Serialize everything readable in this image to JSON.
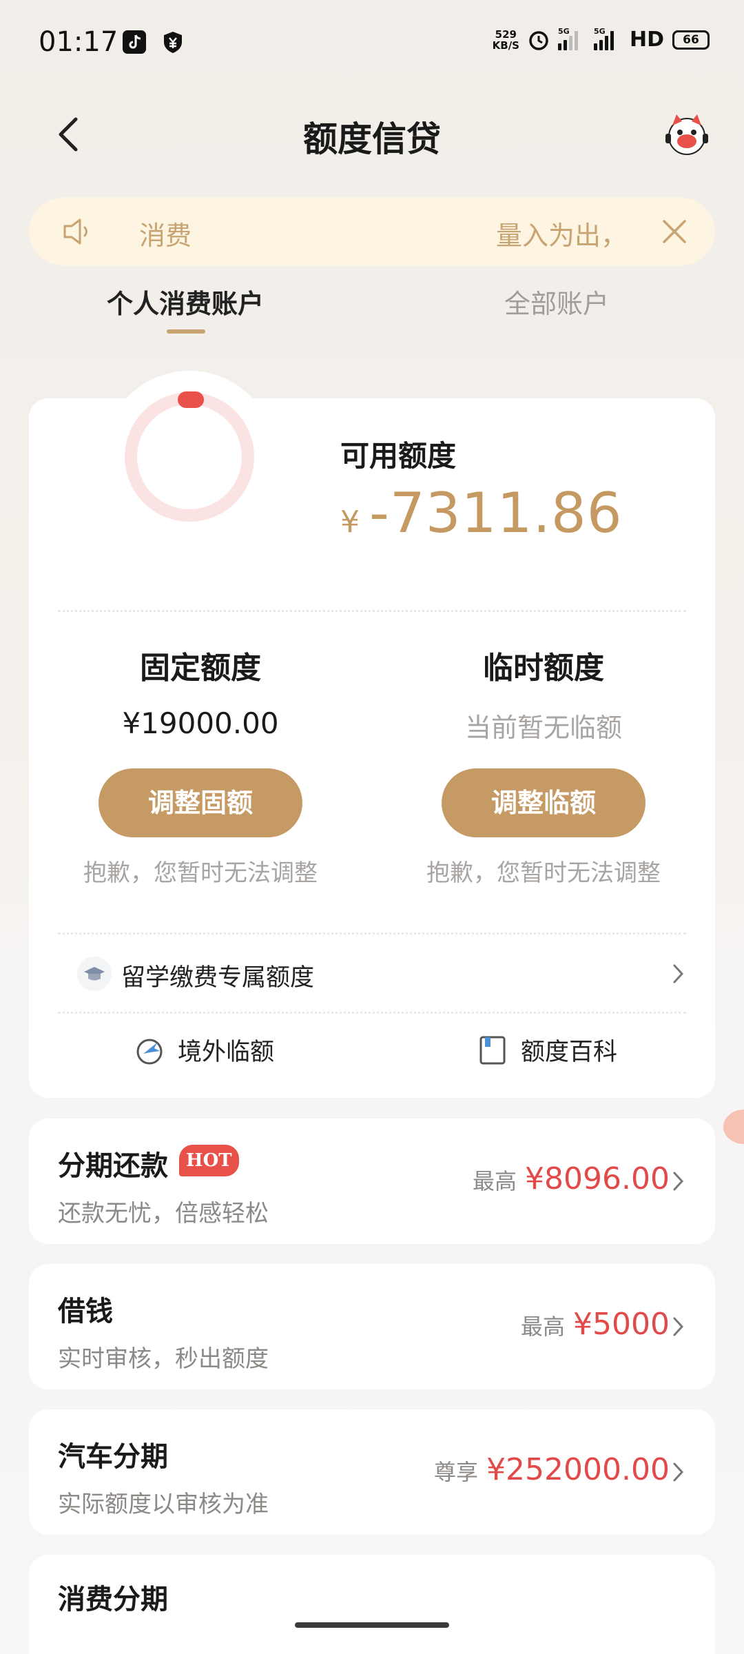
{
  "status_bar": {
    "time": "01:17",
    "net_speed_value": "529",
    "net_speed_unit": "KB/S",
    "sig1_label": "5G",
    "sig2_label": "5G",
    "hd_label": "HD",
    "battery": "66"
  },
  "header": {
    "title": "额度信贷"
  },
  "notice": {
    "label": "消费",
    "text": "量入为出，"
  },
  "tabs": [
    {
      "label": "个人消费账户",
      "active": true
    },
    {
      "label": "全部账户",
      "active": false
    }
  ],
  "credit": {
    "available_label": "可用额度",
    "currency": "¥",
    "available_amount": "-7311.86",
    "ring_usage_fraction": 0.0,
    "fixed": {
      "title": "固定额度",
      "value": "¥19000.00",
      "button": "调整固额",
      "note": "抱歉，您暂时无法调整"
    },
    "temporary": {
      "title": "临时额度",
      "value": "当前暂无临额",
      "button": "调整临额",
      "note": "抱歉，您暂时无法调整"
    },
    "study_abroad_label": "留学缴费专属额度",
    "quick_links": [
      {
        "label": "境外临额",
        "icon": "plane-globe-icon"
      },
      {
        "label": "额度百科",
        "icon": "book-icon"
      }
    ]
  },
  "products": [
    {
      "title": "分期还款",
      "badge": "HOT",
      "subtitle": "还款无忧，倍感轻松",
      "prefix": "最高",
      "amount": "¥8096.00"
    },
    {
      "title": "借钱",
      "badge": "",
      "subtitle": "实时审核，秒出额度",
      "prefix": "最高",
      "amount": "¥5000"
    },
    {
      "title": "汽车分期",
      "badge": "",
      "subtitle": "实际额度以审核为准",
      "prefix": "尊享",
      "amount": "¥252000.00"
    },
    {
      "title": "消费分期",
      "badge": "",
      "subtitle": "",
      "prefix": "",
      "amount": ""
    }
  ],
  "colors": {
    "accent_gold": "#c59a64",
    "amount_red": "#e24a4a",
    "notice_bg": "#fdf4e1",
    "hot_badge": "#e8514a",
    "ring_track": "#fbe3e3",
    "ring_marker": "#e8514a"
  }
}
